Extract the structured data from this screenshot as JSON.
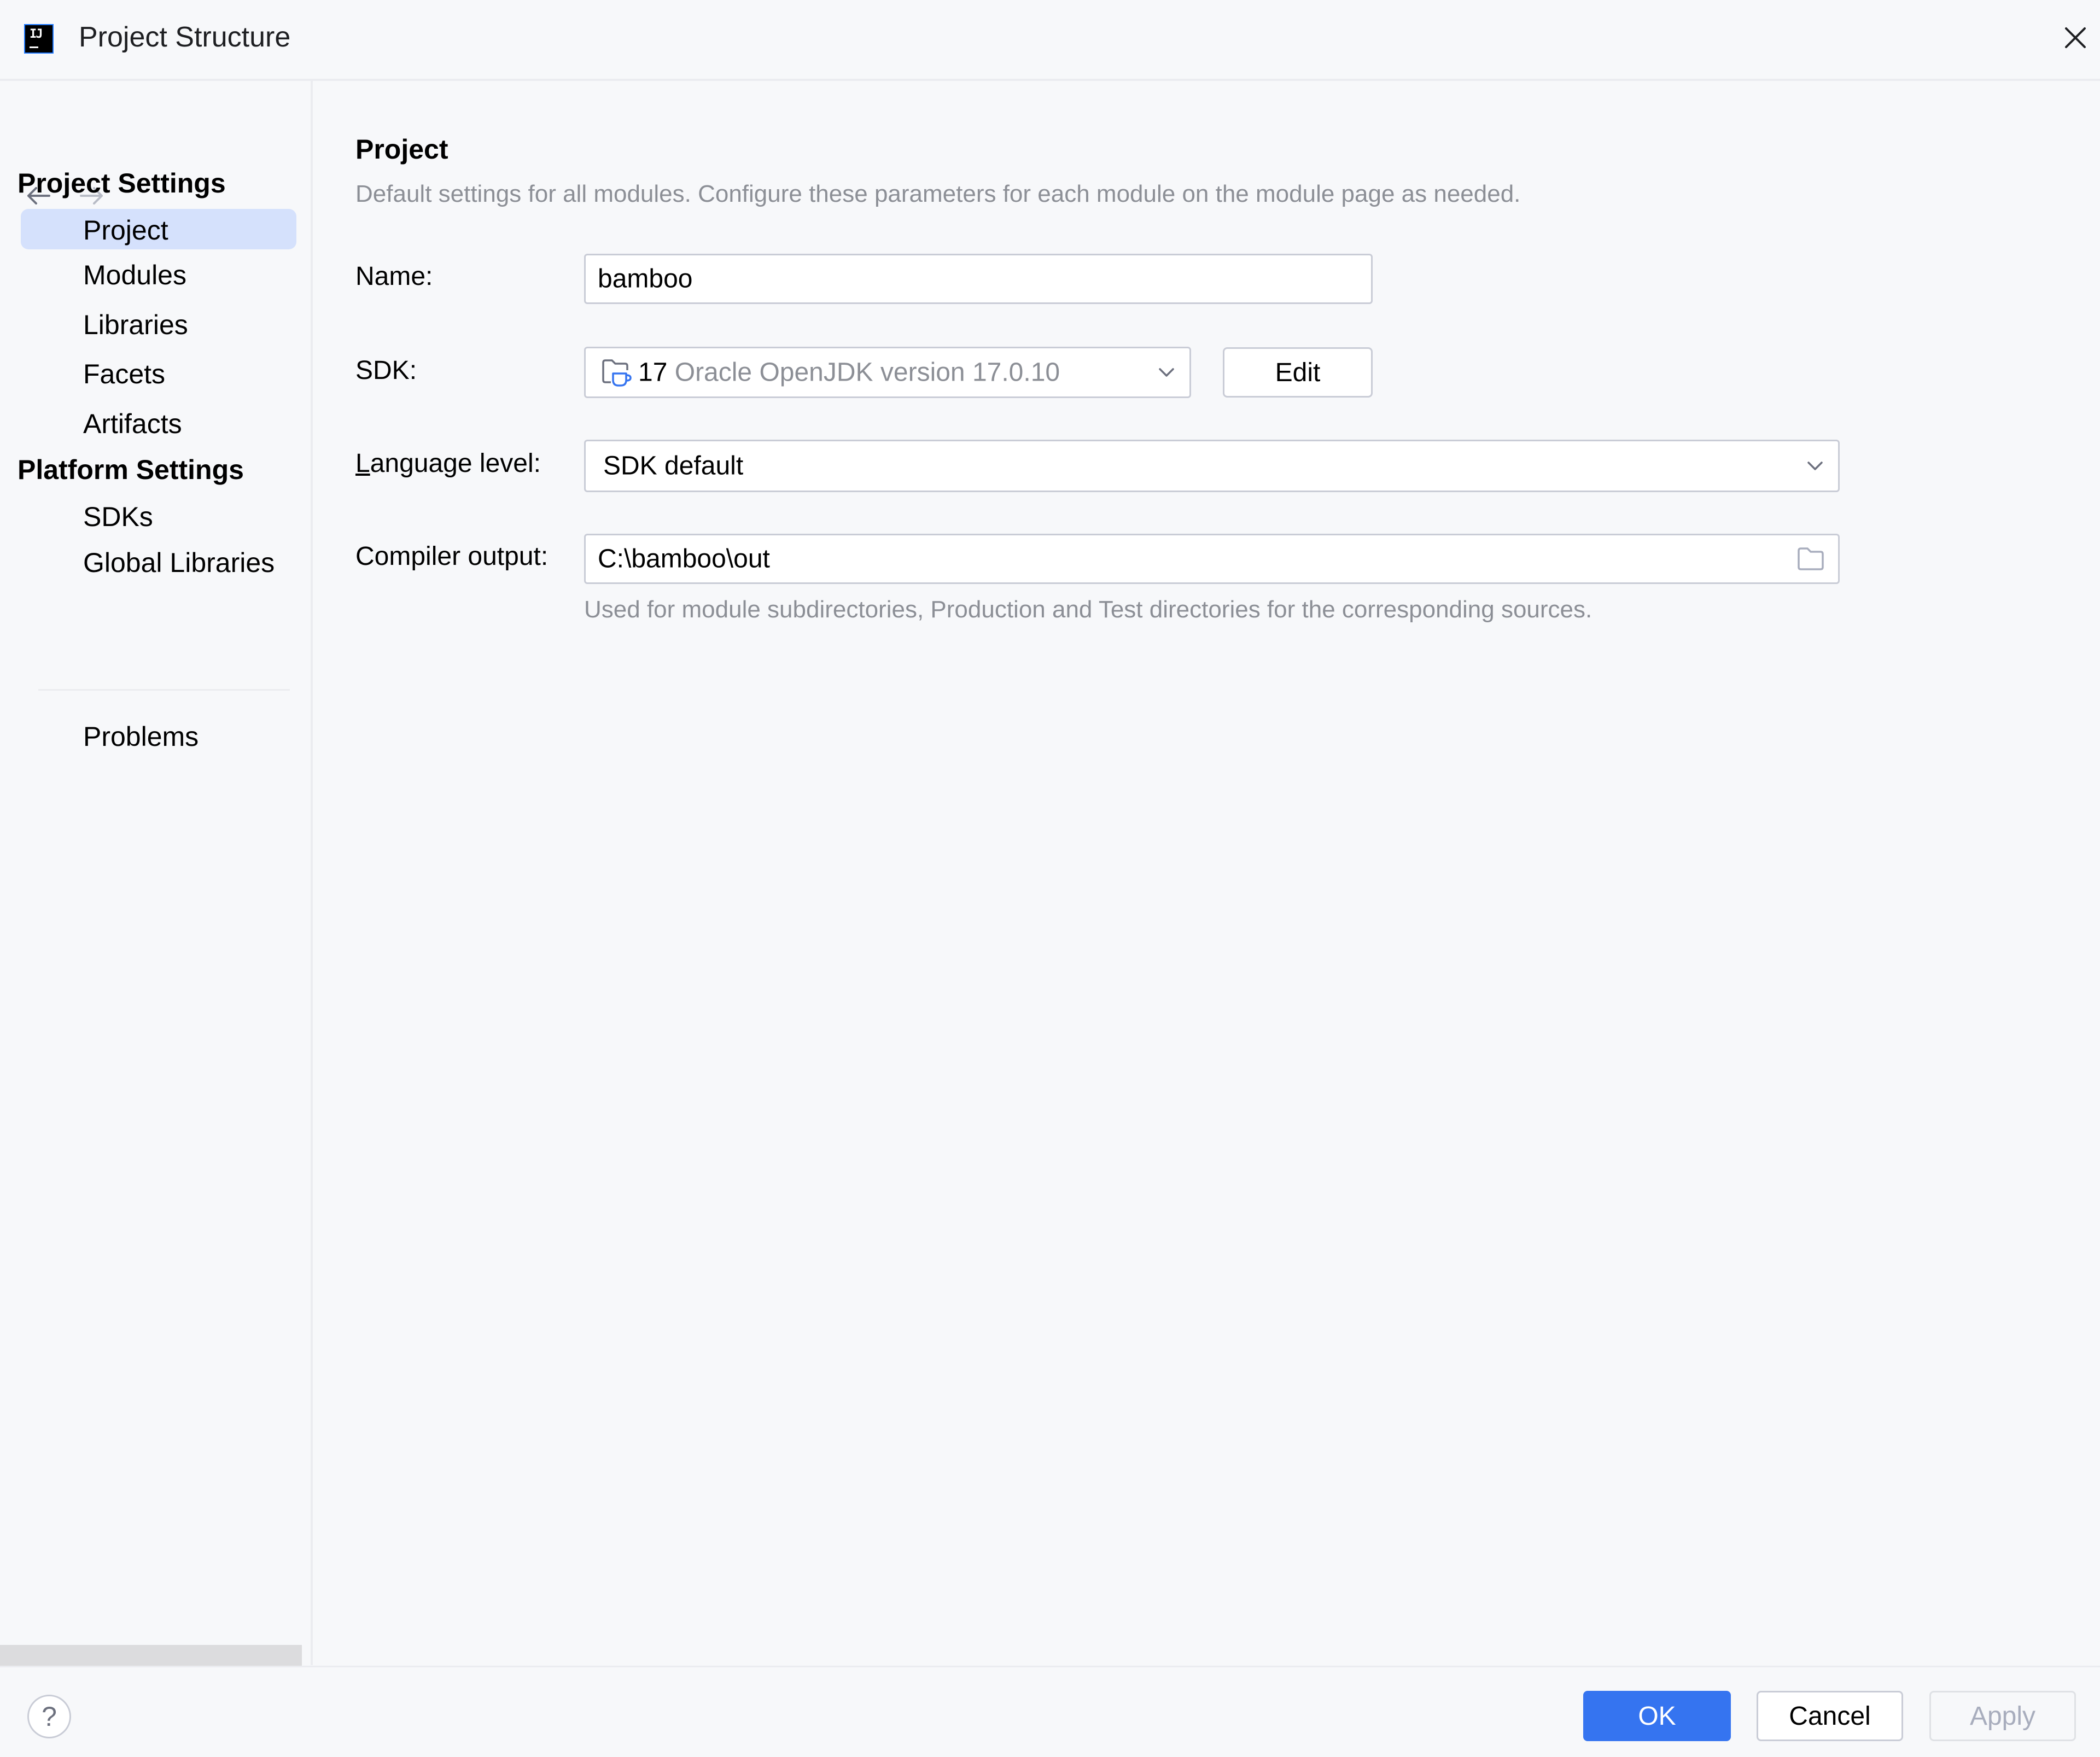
{
  "window": {
    "title": "Project Structure",
    "app_icon": "intellij-idea-icon",
    "close_icon": "close-icon"
  },
  "navigation": {
    "back_icon": "arrow-left-icon",
    "forward_icon": "arrow-right-icon"
  },
  "sidebar": {
    "groups": [
      {
        "header": "Project Settings",
        "items": [
          {
            "label": "Project",
            "selected": true
          },
          {
            "label": "Modules",
            "selected": false
          },
          {
            "label": "Libraries",
            "selected": false
          },
          {
            "label": "Facets",
            "selected": false
          },
          {
            "label": "Artifacts",
            "selected": false
          }
        ]
      },
      {
        "header": "Platform Settings",
        "items": [
          {
            "label": "SDKs",
            "selected": false
          },
          {
            "label": "Global Libraries",
            "selected": false
          }
        ]
      }
    ],
    "extra_items": [
      {
        "label": "Problems",
        "selected": false
      }
    ]
  },
  "main": {
    "title": "Project",
    "description": "Default settings for all modules. Configure these parameters for each module on the module page as needed.",
    "fields": {
      "name": {
        "label": "Name:",
        "value": "bamboo"
      },
      "sdk": {
        "label": "SDK:",
        "version": "17",
        "description": "Oracle OpenJDK version 17.0.10",
        "icon": "jdk-folder-icon",
        "edit_label": "Edit"
      },
      "language_level": {
        "label_mnemonic": "L",
        "label_rest": "anguage level:",
        "value": "SDK default"
      },
      "compiler_output": {
        "label": "Compiler output:",
        "value": "C:\\bamboo\\out",
        "browse_icon": "folder-icon",
        "hint": "Used for module subdirectories, Production and Test directories for the corresponding sources."
      }
    }
  },
  "footer": {
    "help_icon": "help-icon",
    "ok_label": "OK",
    "cancel_label": "Cancel",
    "apply_label": "Apply"
  },
  "colors": {
    "accent": "#3574f0",
    "selection": "#d5e1fc",
    "background": "#f7f8fa",
    "secondary_text": "#8c8f96"
  }
}
